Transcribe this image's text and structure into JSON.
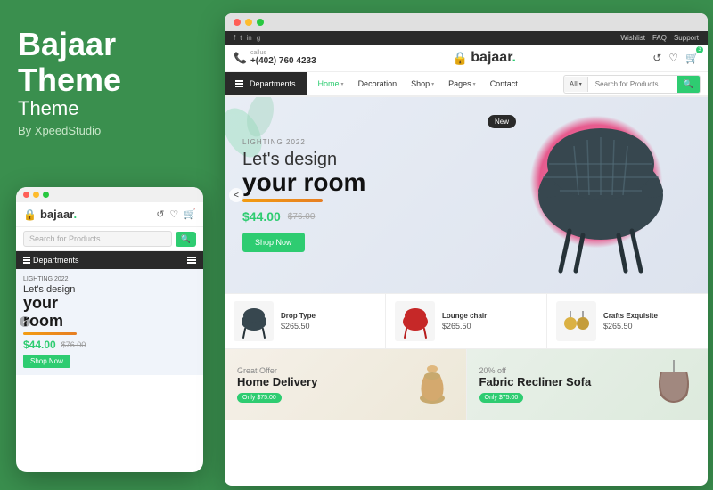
{
  "app": {
    "title": "Bajaar Theme",
    "subtitle": "Theme",
    "by": "By XpeedStudio"
  },
  "mobile": {
    "logo": "bajaar.",
    "logo_dot": ".",
    "search_placeholder": "Search for Products...",
    "search_btn": "🔍",
    "dept_label": "Departments",
    "banner": {
      "tag": "LIGHTING 2022",
      "title1": "Let's design",
      "title2": "your",
      "title3": "room",
      "price": "$44.00",
      "old_price": "$76.00",
      "shop_btn": "Shop Now"
    }
  },
  "desktop": {
    "utility_bar": {
      "social": [
        "f",
        "t",
        "in",
        "g"
      ],
      "links": [
        "Wishlist",
        "FAQ",
        "Support"
      ]
    },
    "header": {
      "call_label": "callus",
      "phone": "+(402) 760 4233",
      "logo": "bajaar.",
      "icons": [
        "♻",
        "♡",
        "🛒"
      ]
    },
    "nav": {
      "dept_btn": "Departments",
      "links": [
        {
          "label": "Home",
          "has_caret": true,
          "active": true
        },
        {
          "label": "Decoration",
          "has_caret": false
        },
        {
          "label": "Shop",
          "has_caret": true
        },
        {
          "label": "Pages",
          "has_caret": true
        },
        {
          "label": "Contact",
          "has_caret": false
        }
      ],
      "search_cat": "All",
      "search_placeholder": "Search for Products..."
    },
    "hero": {
      "tag": "LIGHTING 2022",
      "title1": "Let's design",
      "title2": "your room",
      "price": "$44.00",
      "old_price": "$76.00",
      "shop_btn": "Shop Now",
      "new_badge": "New"
    },
    "products": [
      {
        "name": "Drop Type",
        "price": "$265.50"
      },
      {
        "name": "Lounge chair",
        "price": "$265.50"
      },
      {
        "name": "Crafts Exquisite",
        "price": "$265.50"
      }
    ],
    "promos": [
      {
        "tag": "Great Offer",
        "title": "Home Delivery",
        "badge": "Only $75.00"
      },
      {
        "tag": "20% off",
        "title": "Fabric Recliner Sofa",
        "badge": "Only $75.00"
      }
    ]
  }
}
